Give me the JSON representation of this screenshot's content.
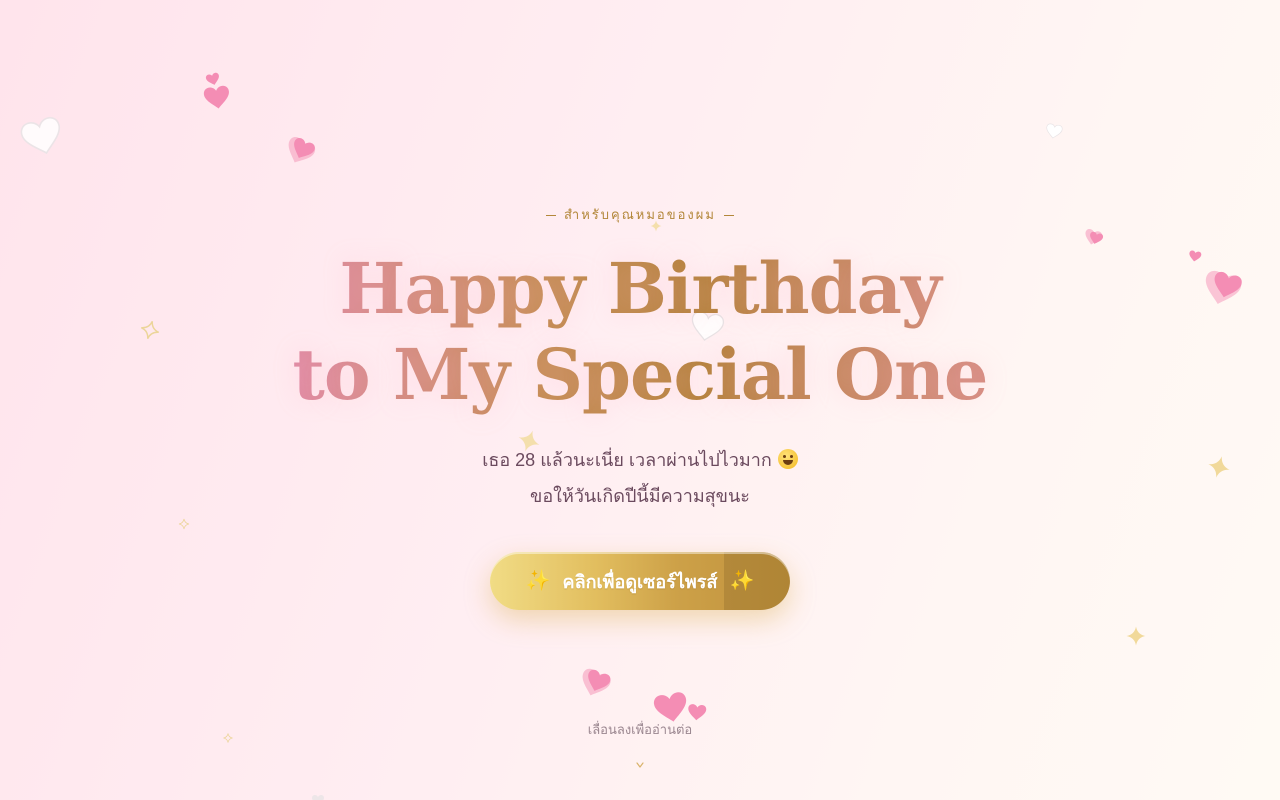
{
  "hero": {
    "eyebrow": "สำหรับคุณหมอของผม",
    "headline_line1": "Happy Birthday",
    "headline_line2": "to My Special One",
    "subtext_line1": "เธอ 28 แล้วนะเนี่ย เวลาผ่านไปไวมาก",
    "subtext_emoji": "grinning-face-icon",
    "subtext_line2": "ขอให้วันเกิดปีนี้มีความสุขนะ",
    "cta_label": "คลิกเพื่อดูเซอร์ไพรส์",
    "cta_icon": "sparkles-icon"
  },
  "scroll": {
    "hint": "เลื่อนลงเพื่ออ่านต่อ",
    "icon": "chevron-down-icon"
  },
  "colors": {
    "accent_gold": "#b3873a",
    "accent_pink": "#ec8fb4",
    "text": "#6b4a5e",
    "background": "#ffeef2"
  }
}
